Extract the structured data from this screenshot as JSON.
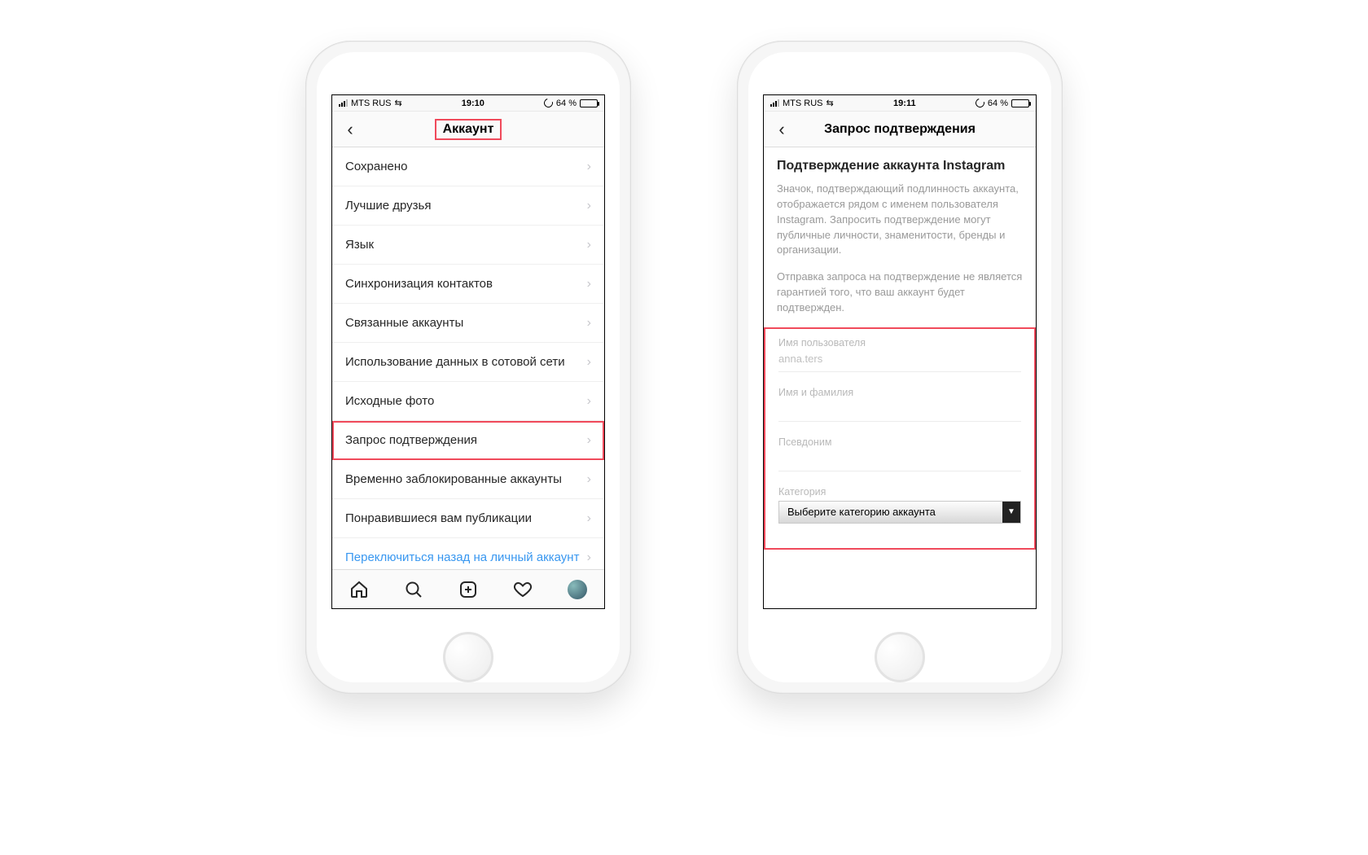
{
  "status": {
    "carrier": "MTS RUS",
    "wifi_icon": "⇆",
    "battery_pct": "64 %",
    "reload_icon": "↻"
  },
  "left": {
    "time": "19:10",
    "title": "Аккаунт",
    "rows": [
      {
        "label": "Сохранено",
        "hl": false,
        "link": false
      },
      {
        "label": "Лучшие друзья",
        "hl": false,
        "link": false
      },
      {
        "label": "Язык",
        "hl": false,
        "link": false
      },
      {
        "label": "Синхронизация контактов",
        "hl": false,
        "link": false
      },
      {
        "label": "Связанные аккаунты",
        "hl": false,
        "link": false
      },
      {
        "label": "Использование данных в сотовой сети",
        "hl": false,
        "link": false
      },
      {
        "label": "Исходные фото",
        "hl": false,
        "link": false
      },
      {
        "label": "Запрос подтверждения",
        "hl": true,
        "link": false
      },
      {
        "label": "Временно заблокированные аккаунты",
        "hl": false,
        "link": false
      },
      {
        "label": "Понравившиеся вам публикации",
        "hl": false,
        "link": false
      },
      {
        "label": "Переключиться назад на личный аккаунт",
        "hl": false,
        "link": true
      }
    ]
  },
  "right": {
    "time": "19:11",
    "title": "Запрос подтверждения",
    "heading": "Подтверждение аккаунта Instagram",
    "para1": "Значок, подтверждающий подлинность аккаунта, отображается рядом с именем пользователя Instagram. Запросить подтверждение могут публичные личности, знаменитости, бренды и организации.",
    "para2": "Отправка запроса на подтверждение не является гарантией того, что ваш аккаунт будет подтвержден.",
    "fields": {
      "username_label": "Имя пользователя",
      "username_value": "anna.ters",
      "fullname_label": "Имя и фамилия",
      "alias_label": "Псевдоним",
      "category_label": "Категория",
      "category_placeholder": "Выберите категорию аккаунта"
    }
  }
}
